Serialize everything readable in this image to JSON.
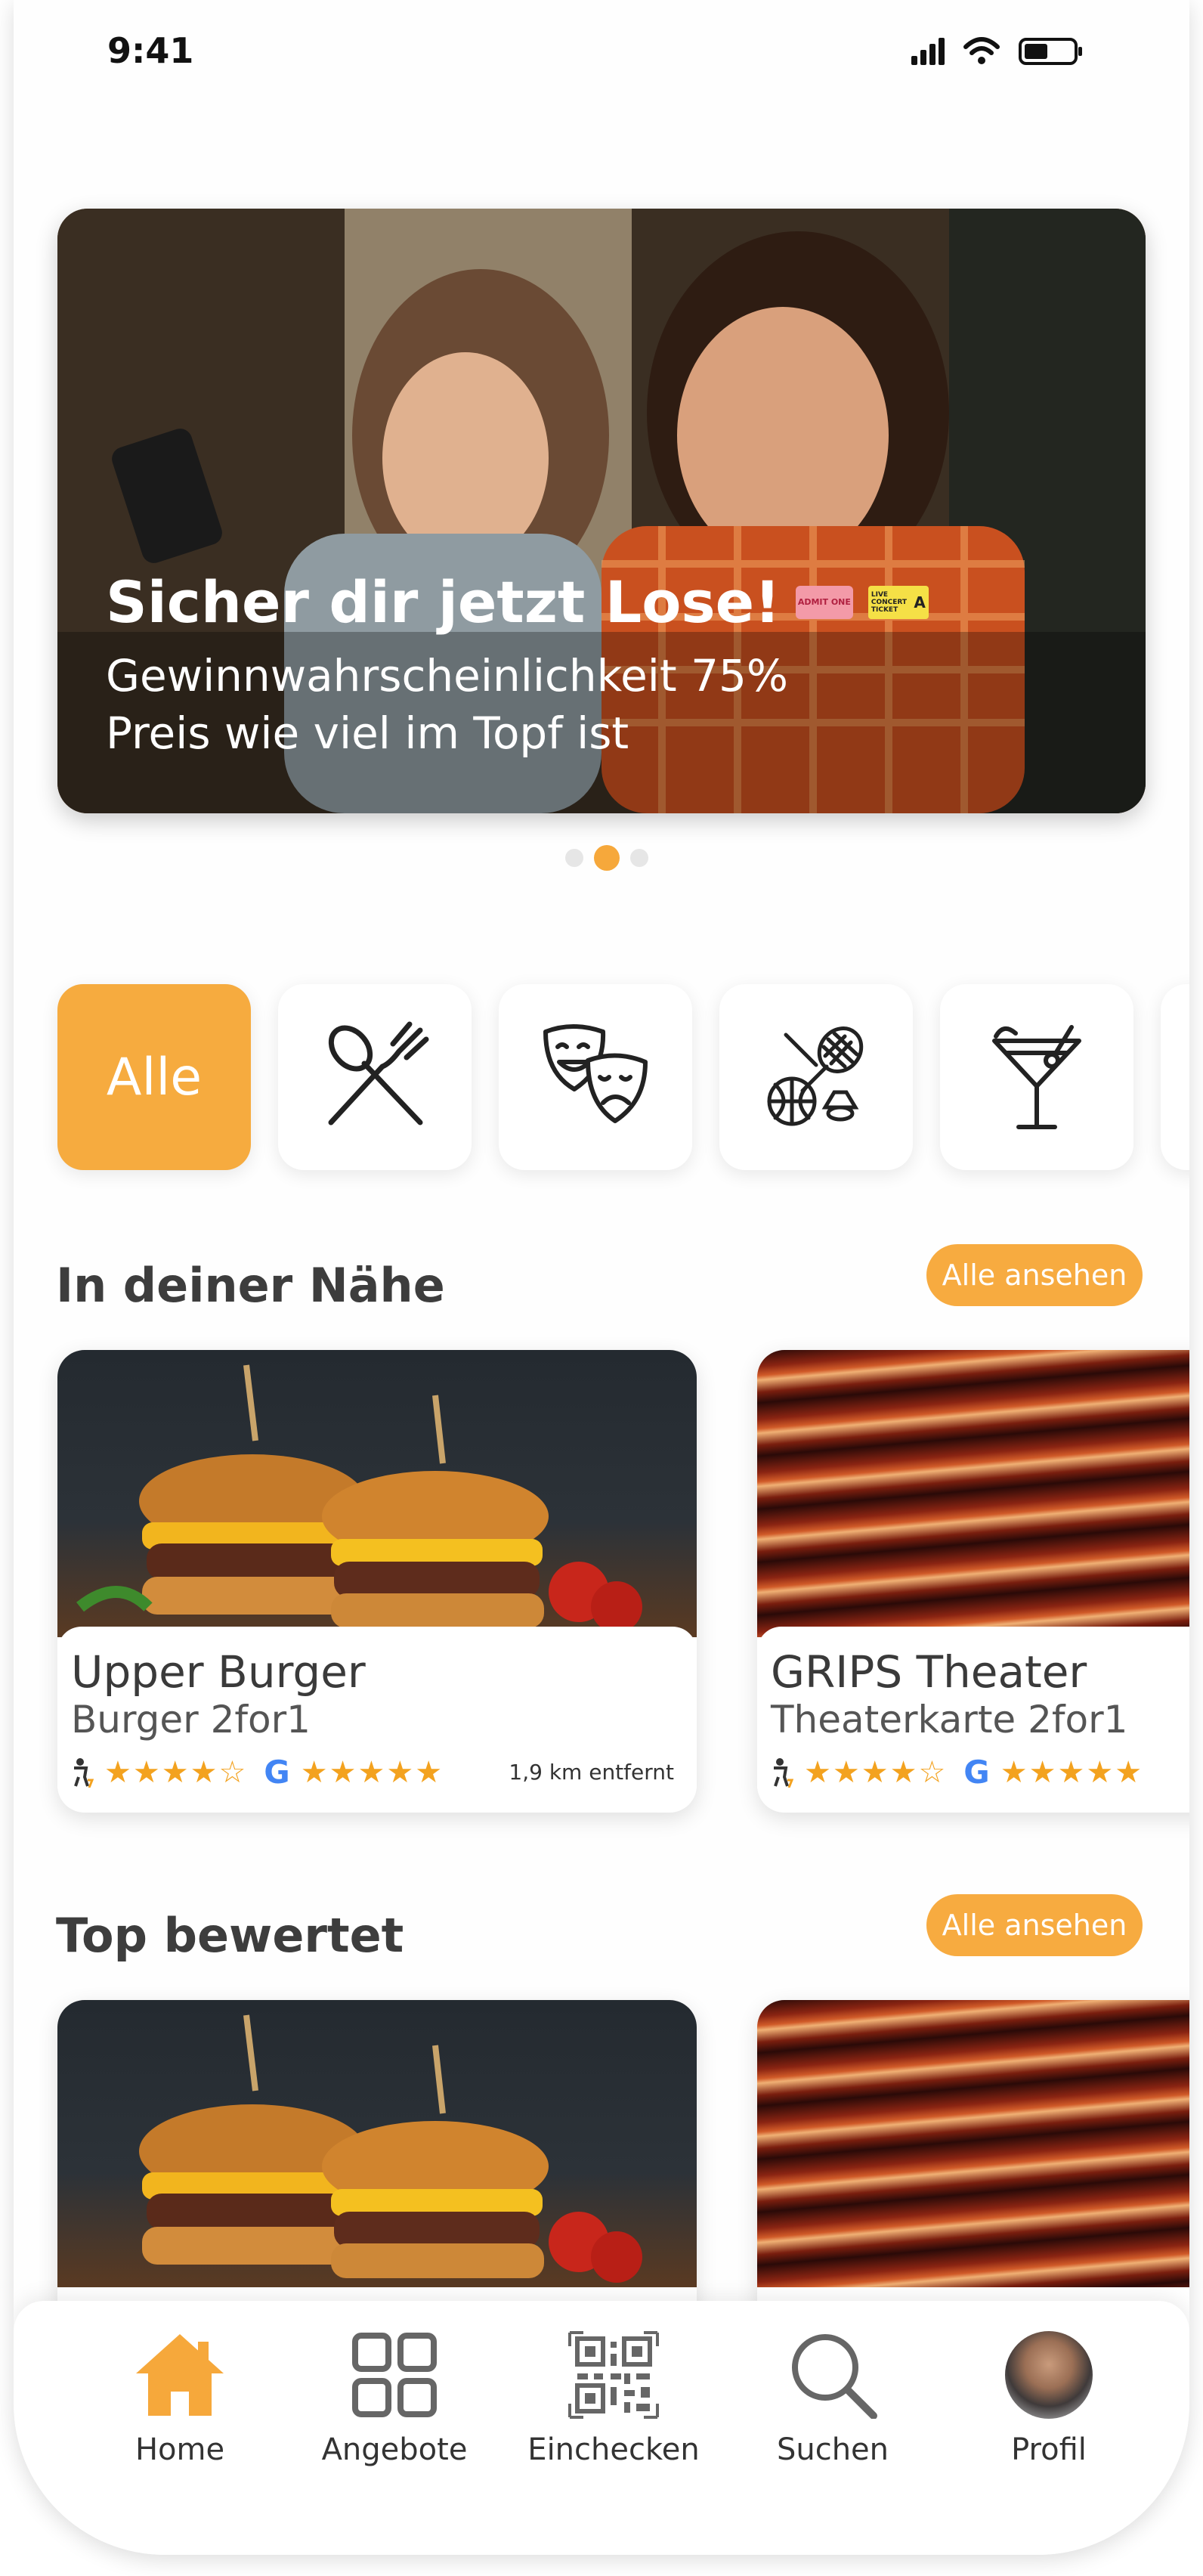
{
  "status_bar": {
    "time": "9:41"
  },
  "hero": {
    "title": "Sicher dir jetzt Lose!",
    "line1": "Gewinnwahrscheinlichkeit 75%",
    "line2": "Preis wie viel im Topf ist",
    "ticket_admit": "ADMIT ONE",
    "ticket_concert": "LIVE CONCERT TICKET",
    "ticket_letter": "A",
    "dots_count": 3,
    "dots_active": 1
  },
  "categories": [
    {
      "label": "Alle",
      "icon": "all"
    },
    {
      "icon": "fork-spoon-icon"
    },
    {
      "icon": "theater-masks-icon"
    },
    {
      "icon": "sports-icon"
    },
    {
      "icon": "cocktail-icon"
    }
  ],
  "section_nearby": {
    "title": "In deiner Nähe",
    "see_all": "Alle ansehen",
    "cards": [
      {
        "title": "Upper Burger",
        "subtitle": "Burger 2for1",
        "user_stars": "★★★★☆",
        "google_stars": "★★★★★",
        "distance": "1,9 km entfernt"
      },
      {
        "title": "GRIPS Theater",
        "subtitle": "Theaterkarte 2for1",
        "user_stars": "★★★★☆",
        "google_stars": "★★★★★"
      }
    ]
  },
  "section_top": {
    "title": "Top bewertet",
    "see_all": "Alle ansehen"
  },
  "nav": {
    "home": "Home",
    "offers": "Angebote",
    "checkin": "Einchecken",
    "search": "Suchen",
    "profile": "Profil"
  },
  "colors": {
    "accent": "#f6a83b",
    "star": "#f3a21f"
  }
}
